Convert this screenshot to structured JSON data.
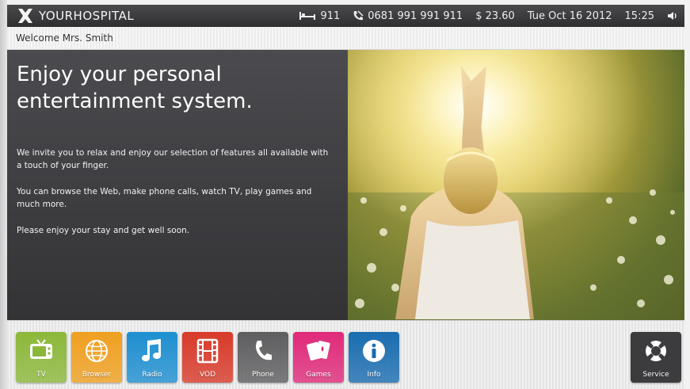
{
  "topbar": {
    "brand": "YOURHOSPITAL",
    "emergency": "911",
    "phone_number": "0681 991 991 911",
    "balance": "$ 23.60",
    "date": "Tue Oct 16 2012",
    "time": "15:25"
  },
  "welcome": "Welcome Mrs. Smith",
  "main": {
    "headline": "Enjoy your personal entertainment system.",
    "paragraphs": [
      "We invite you to relax and enjoy our selection of features all available with a touch of your finger.",
      "You can browse the Web, make phone calls, watch TV, play games and much more.",
      "Please enjoy your stay and get well soon."
    ]
  },
  "dock": {
    "tiles": [
      {
        "label": "TV",
        "icon": "tv-icon",
        "color": "#8cb83a"
      },
      {
        "label": "Browser",
        "icon": "globe-icon",
        "color": "#f0a020"
      },
      {
        "label": "Radio",
        "icon": "music-note-icon",
        "color": "#1e8fd0"
      },
      {
        "label": "VOD",
        "icon": "film-icon",
        "color": "#d83a2a"
      },
      {
        "label": "Phone",
        "icon": "phone-icon",
        "color": "#5e5e60"
      },
      {
        "label": "Games",
        "icon": "cards-icon",
        "color": "#e02a7a"
      },
      {
        "label": "Info",
        "icon": "info-icon",
        "color": "#1a6db0"
      }
    ],
    "service": {
      "label": "Service",
      "icon": "lifebuoy-icon",
      "color": "#3c3c3e"
    }
  }
}
